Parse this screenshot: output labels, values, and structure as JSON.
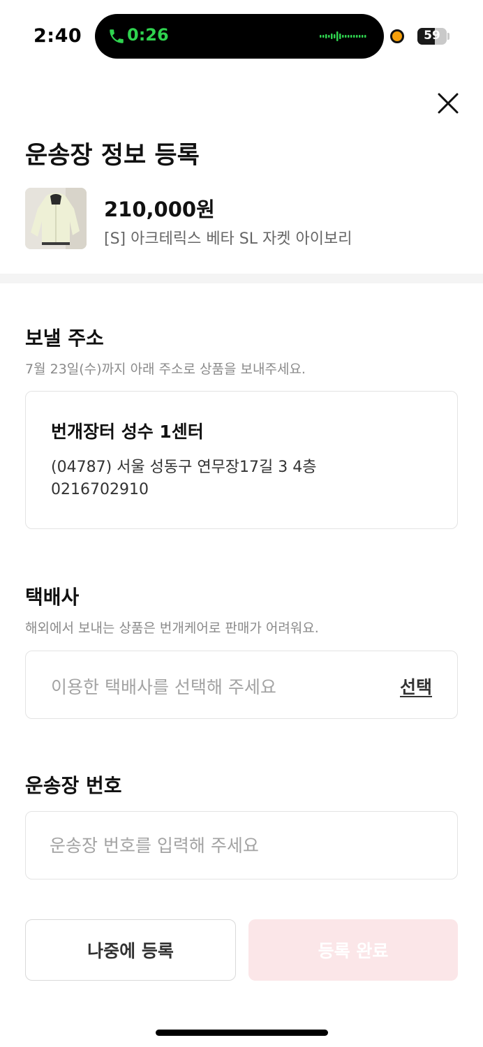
{
  "status_bar": {
    "time": "2:40",
    "call_duration": "0:26",
    "battery": "59",
    "battery_level": 0.59,
    "call_color": "#2fd34f",
    "recording_dot_color": "#f59f0b"
  },
  "header": {
    "title": "운송장 정보 등록"
  },
  "product": {
    "price": "210,000원",
    "name": "[S] 아크테릭스 베타 SL 자켓 아이보리"
  },
  "send_address": {
    "title": "보낼 주소",
    "description": "7월 23일(수)까지 아래 주소로 상품을 보내주세요.",
    "center_name": "번개장터 성수 1센터",
    "address": "(04787) 서울 성동구 연무장17길 3 4층",
    "phone": "0216702910"
  },
  "courier": {
    "title": "택배사",
    "description": "해외에서 보내는 상품은 번개케어로 판매가 어려워요.",
    "placeholder": "이용한 택배사를 선택해 주세요",
    "select_label": "선택"
  },
  "tracking": {
    "title": "운송장 번호",
    "placeholder": "운송장 번호를 입력해 주세요"
  },
  "buttons": {
    "later_label": "나중에 등록",
    "done_label": "등록 완료",
    "done_color": "#fbe6e8"
  }
}
